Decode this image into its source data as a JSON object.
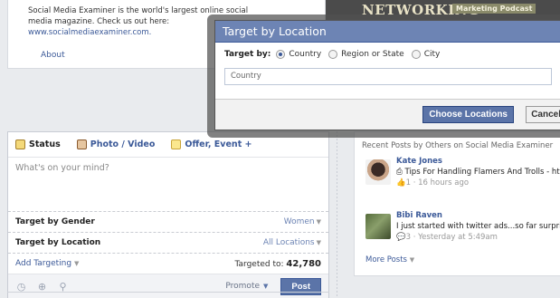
{
  "about": {
    "text": "Social Media Examiner is the world's largest online social media magazine. Check us out here:",
    "url": "www.socialmediaexaminer.com.",
    "link": "About"
  },
  "banner": {
    "title": "NETWORKING",
    "podcast": "Marketing Podcast"
  },
  "composer": {
    "tabs": [
      {
        "label": "Status",
        "icon": "status-icon"
      },
      {
        "label": "Photo / Video",
        "icon": "photo-icon"
      },
      {
        "label": "Offer, Event +",
        "icon": "offer-icon"
      }
    ],
    "placeholder": "What's on your mind?",
    "gender": {
      "label": "Target by Gender",
      "value": "Women"
    },
    "location": {
      "label": "Target by Location",
      "value": "All Locations"
    },
    "add_targeting": "Add Targeting",
    "targeted_prefix": "Targeted to:",
    "targeted_count": "42,780",
    "promote": "Promote",
    "post": "Post"
  },
  "recent": {
    "heading": "Recent Posts by Others on Social Media Examiner",
    "posts": [
      {
        "name": "Kate Jones",
        "text": "Tips For Handling Flamers And Trolls - http",
        "count": "1",
        "time": "· 16 hours ago"
      },
      {
        "name": "Bibi Raven",
        "text": "I just started with twitter ads...so far surpri",
        "count": "3",
        "time": "· Yesterday at 5:49am"
      }
    ],
    "more": "More Posts"
  },
  "modal": {
    "title": "Target by Location",
    "target_by": "Target by:",
    "options": [
      "Country",
      "Region or State",
      "City"
    ],
    "selected": "Country",
    "input_value": "Country",
    "choose": "Choose Locations",
    "cancel": "Cancel"
  }
}
